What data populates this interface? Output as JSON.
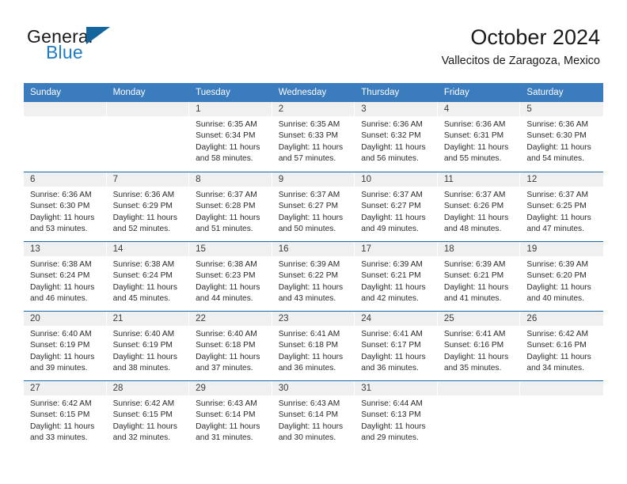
{
  "brand": {
    "name_top": "General",
    "name_bottom": "Blue",
    "flag_icon": "flag-triangle-icon",
    "accent_color": "#15659f",
    "blue_text_color": "#1f7bc4"
  },
  "header": {
    "title": "October 2024",
    "subtitle": "Vallecitos de Zaragoza, Mexico"
  },
  "calendar": {
    "header_bg": "#3a7cbe",
    "row_separator_color": "#1a6aaa",
    "daynum_band_color": "#f0f0f0",
    "weekdays": [
      "Sunday",
      "Monday",
      "Tuesday",
      "Wednesday",
      "Thursday",
      "Friday",
      "Saturday"
    ],
    "weeks": [
      [
        {
          "day": "",
          "empty": true
        },
        {
          "day": "",
          "empty": true
        },
        {
          "day": "1",
          "sunrise": "Sunrise: 6:35 AM",
          "sunset": "Sunset: 6:34 PM",
          "daylight1": "Daylight: 11 hours",
          "daylight2": "and 58 minutes."
        },
        {
          "day": "2",
          "sunrise": "Sunrise: 6:35 AM",
          "sunset": "Sunset: 6:33 PM",
          "daylight1": "Daylight: 11 hours",
          "daylight2": "and 57 minutes."
        },
        {
          "day": "3",
          "sunrise": "Sunrise: 6:36 AM",
          "sunset": "Sunset: 6:32 PM",
          "daylight1": "Daylight: 11 hours",
          "daylight2": "and 56 minutes."
        },
        {
          "day": "4",
          "sunrise": "Sunrise: 6:36 AM",
          "sunset": "Sunset: 6:31 PM",
          "daylight1": "Daylight: 11 hours",
          "daylight2": "and 55 minutes."
        },
        {
          "day": "5",
          "sunrise": "Sunrise: 6:36 AM",
          "sunset": "Sunset: 6:30 PM",
          "daylight1": "Daylight: 11 hours",
          "daylight2": "and 54 minutes."
        }
      ],
      [
        {
          "day": "6",
          "sunrise": "Sunrise: 6:36 AM",
          "sunset": "Sunset: 6:30 PM",
          "daylight1": "Daylight: 11 hours",
          "daylight2": "and 53 minutes."
        },
        {
          "day": "7",
          "sunrise": "Sunrise: 6:36 AM",
          "sunset": "Sunset: 6:29 PM",
          "daylight1": "Daylight: 11 hours",
          "daylight2": "and 52 minutes."
        },
        {
          "day": "8",
          "sunrise": "Sunrise: 6:37 AM",
          "sunset": "Sunset: 6:28 PM",
          "daylight1": "Daylight: 11 hours",
          "daylight2": "and 51 minutes."
        },
        {
          "day": "9",
          "sunrise": "Sunrise: 6:37 AM",
          "sunset": "Sunset: 6:27 PM",
          "daylight1": "Daylight: 11 hours",
          "daylight2": "and 50 minutes."
        },
        {
          "day": "10",
          "sunrise": "Sunrise: 6:37 AM",
          "sunset": "Sunset: 6:27 PM",
          "daylight1": "Daylight: 11 hours",
          "daylight2": "and 49 minutes."
        },
        {
          "day": "11",
          "sunrise": "Sunrise: 6:37 AM",
          "sunset": "Sunset: 6:26 PM",
          "daylight1": "Daylight: 11 hours",
          "daylight2": "and 48 minutes."
        },
        {
          "day": "12",
          "sunrise": "Sunrise: 6:37 AM",
          "sunset": "Sunset: 6:25 PM",
          "daylight1": "Daylight: 11 hours",
          "daylight2": "and 47 minutes."
        }
      ],
      [
        {
          "day": "13",
          "sunrise": "Sunrise: 6:38 AM",
          "sunset": "Sunset: 6:24 PM",
          "daylight1": "Daylight: 11 hours",
          "daylight2": "and 46 minutes."
        },
        {
          "day": "14",
          "sunrise": "Sunrise: 6:38 AM",
          "sunset": "Sunset: 6:24 PM",
          "daylight1": "Daylight: 11 hours",
          "daylight2": "and 45 minutes."
        },
        {
          "day": "15",
          "sunrise": "Sunrise: 6:38 AM",
          "sunset": "Sunset: 6:23 PM",
          "daylight1": "Daylight: 11 hours",
          "daylight2": "and 44 minutes."
        },
        {
          "day": "16",
          "sunrise": "Sunrise: 6:39 AM",
          "sunset": "Sunset: 6:22 PM",
          "daylight1": "Daylight: 11 hours",
          "daylight2": "and 43 minutes."
        },
        {
          "day": "17",
          "sunrise": "Sunrise: 6:39 AM",
          "sunset": "Sunset: 6:21 PM",
          "daylight1": "Daylight: 11 hours",
          "daylight2": "and 42 minutes."
        },
        {
          "day": "18",
          "sunrise": "Sunrise: 6:39 AM",
          "sunset": "Sunset: 6:21 PM",
          "daylight1": "Daylight: 11 hours",
          "daylight2": "and 41 minutes."
        },
        {
          "day": "19",
          "sunrise": "Sunrise: 6:39 AM",
          "sunset": "Sunset: 6:20 PM",
          "daylight1": "Daylight: 11 hours",
          "daylight2": "and 40 minutes."
        }
      ],
      [
        {
          "day": "20",
          "sunrise": "Sunrise: 6:40 AM",
          "sunset": "Sunset: 6:19 PM",
          "daylight1": "Daylight: 11 hours",
          "daylight2": "and 39 minutes."
        },
        {
          "day": "21",
          "sunrise": "Sunrise: 6:40 AM",
          "sunset": "Sunset: 6:19 PM",
          "daylight1": "Daylight: 11 hours",
          "daylight2": "and 38 minutes."
        },
        {
          "day": "22",
          "sunrise": "Sunrise: 6:40 AM",
          "sunset": "Sunset: 6:18 PM",
          "daylight1": "Daylight: 11 hours",
          "daylight2": "and 37 minutes."
        },
        {
          "day": "23",
          "sunrise": "Sunrise: 6:41 AM",
          "sunset": "Sunset: 6:18 PM",
          "daylight1": "Daylight: 11 hours",
          "daylight2": "and 36 minutes."
        },
        {
          "day": "24",
          "sunrise": "Sunrise: 6:41 AM",
          "sunset": "Sunset: 6:17 PM",
          "daylight1": "Daylight: 11 hours",
          "daylight2": "and 36 minutes."
        },
        {
          "day": "25",
          "sunrise": "Sunrise: 6:41 AM",
          "sunset": "Sunset: 6:16 PM",
          "daylight1": "Daylight: 11 hours",
          "daylight2": "and 35 minutes."
        },
        {
          "day": "26",
          "sunrise": "Sunrise: 6:42 AM",
          "sunset": "Sunset: 6:16 PM",
          "daylight1": "Daylight: 11 hours",
          "daylight2": "and 34 minutes."
        }
      ],
      [
        {
          "day": "27",
          "sunrise": "Sunrise: 6:42 AM",
          "sunset": "Sunset: 6:15 PM",
          "daylight1": "Daylight: 11 hours",
          "daylight2": "and 33 minutes."
        },
        {
          "day": "28",
          "sunrise": "Sunrise: 6:42 AM",
          "sunset": "Sunset: 6:15 PM",
          "daylight1": "Daylight: 11 hours",
          "daylight2": "and 32 minutes."
        },
        {
          "day": "29",
          "sunrise": "Sunrise: 6:43 AM",
          "sunset": "Sunset: 6:14 PM",
          "daylight1": "Daylight: 11 hours",
          "daylight2": "and 31 minutes."
        },
        {
          "day": "30",
          "sunrise": "Sunrise: 6:43 AM",
          "sunset": "Sunset: 6:14 PM",
          "daylight1": "Daylight: 11 hours",
          "daylight2": "and 30 minutes."
        },
        {
          "day": "31",
          "sunrise": "Sunrise: 6:44 AM",
          "sunset": "Sunset: 6:13 PM",
          "daylight1": "Daylight: 11 hours",
          "daylight2": "and 29 minutes."
        },
        {
          "day": "",
          "empty": true
        },
        {
          "day": "",
          "empty": true
        }
      ]
    ]
  }
}
